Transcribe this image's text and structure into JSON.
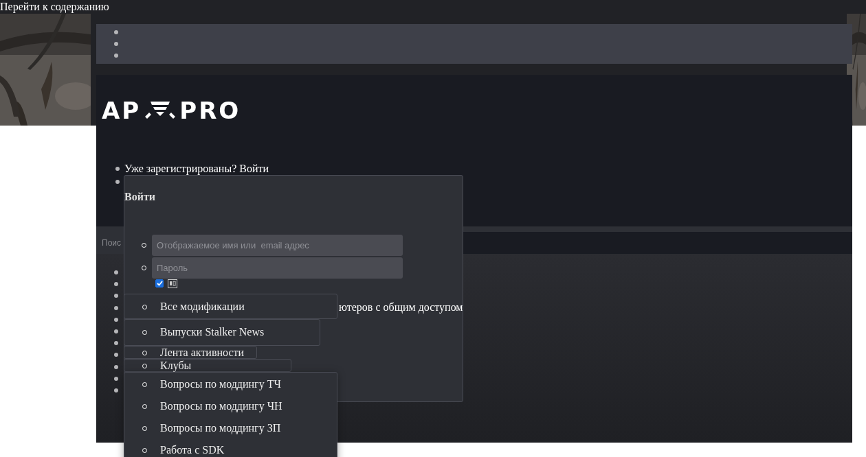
{
  "skip_link": "Перейти к содержанию",
  "top_nav": [
    {
      "kind": "bullet"
    },
    {
      "kind": "bullet"
    },
    {
      "kind": "bullet"
    }
  ],
  "logo": {
    "left": "AP",
    "right": "PRO"
  },
  "user_menu": [
    {
      "kind": "text",
      "label": "Уже зарегистрированы? Войти"
    },
    {
      "kind": "bullet"
    }
  ],
  "search": {
    "placeholder": "Поис"
  },
  "content_list": [
    {
      "kind": "bullet"
    },
    {
      "kind": "bullet"
    },
    {
      "kind": "bullet"
    },
    {
      "kind": "bullet"
    },
    {
      "kind": "bullet"
    },
    {
      "kind": "bullet"
    },
    {
      "kind": "bullet"
    },
    {
      "kind": "bullet"
    },
    {
      "kind": "bullet"
    },
    {
      "kind": "bullet"
    },
    {
      "kind": "bullet"
    }
  ],
  "login_popup": {
    "title": "Войти",
    "fields": [
      {
        "placeholder": "Отображаемое имя или  email адрес"
      },
      {
        "placeholder": "Пароль"
      }
    ],
    "remember": {
      "checked": true
    },
    "note": "ютеров с общим доступом"
  },
  "dropdowns": [
    {
      "items": [
        "Все модификации"
      ]
    },
    {
      "items": [
        "Выпуски Stalker News"
      ]
    },
    {
      "items": [
        "Лента активности"
      ]
    },
    {
      "items": [
        "Клубы"
      ]
    },
    {
      "items": [
        "Вопросы по моддингу ТЧ",
        "Вопросы по моддингу ЧН",
        "Вопросы по моддингу ЗП",
        "Работа с SDK"
      ]
    }
  ]
}
